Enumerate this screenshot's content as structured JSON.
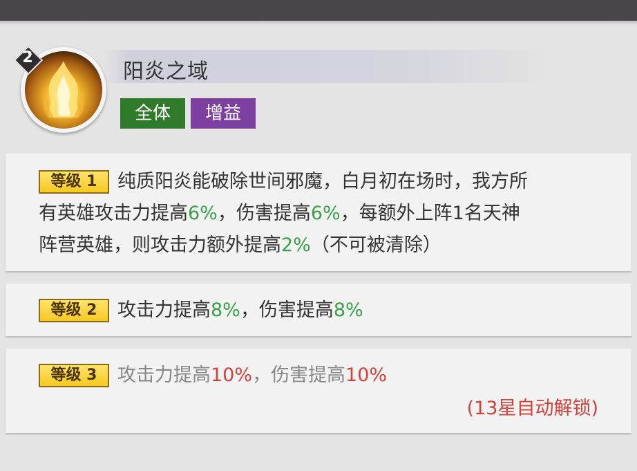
{
  "skill": {
    "level": "2",
    "name": "阳炎之域",
    "icon": "flame-icon",
    "tags": [
      "全体",
      "增益"
    ]
  },
  "levels": [
    {
      "badge": "等级 1",
      "line1": {
        "a": "纯质阳炎能破除世间邪魔，白月初在场时，我方所"
      },
      "line2": {
        "a": "有英雄攻击力提高",
        "b": "6%",
        "c": "，伤害提高",
        "d": "6%",
        "e": "，每额外上阵1名天神"
      },
      "line3": {
        "a": "阵营英雄，则攻击力额外提高",
        "b": "2%",
        "c": "（不可被清除）"
      }
    },
    {
      "badge": "等级 2",
      "line1": {
        "a": "攻击力提高",
        "b": "8%",
        "c": "，伤害提高",
        "d": "8%"
      }
    },
    {
      "badge": "等级 3",
      "line1": {
        "a": "攻击力提高",
        "b": "10%",
        "c": "，伤害提高",
        "d": "10%"
      },
      "unlock": "(13星自动解锁)"
    }
  ],
  "colors": {
    "highlight_green": "#3aa04a",
    "locked_red": "#d2413a",
    "tag_all": "#2f7a2b",
    "tag_buff": "#7d3fa0",
    "badge_gold": "#f6c822"
  }
}
